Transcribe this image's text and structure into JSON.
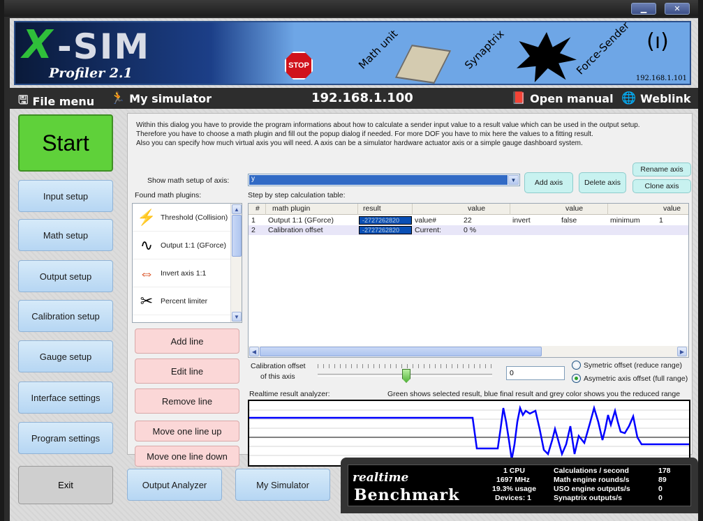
{
  "window": {
    "minimize": "▁",
    "close": "✕"
  },
  "banner": {
    "version": "Profiler 2.1",
    "math": "Math unit",
    "synaptrix": "Synaptrix",
    "force": "Force-Sender",
    "stop": "STOP",
    "ip": "192.168.1.101"
  },
  "menu": {
    "file": "File menu",
    "simulator": "My simulator",
    "ip": "192.168.1.100",
    "manual": "Open manual",
    "weblink": "Weblink"
  },
  "sidebar": {
    "start": "Start",
    "items": [
      "Input setup",
      "Math setup",
      "Output setup",
      "Calibration setup",
      "Gauge setup",
      "Interface settings",
      "Program settings"
    ],
    "exit": "Exit"
  },
  "intro": [
    "Within this dialog you have to provide the program informations about how to calculate a sender input value to a result value which can be used in the output setup.",
    "Therefore you have to choose a math plugin and fill out the popup dialog if needed. For more DOF you have to mix here the values to a fitting result.",
    "Also you can specify how much virtual axis you will need. A axis can be a simulator hardware actuator axis or a simple gauge dashboard system."
  ],
  "axis": {
    "label": "Show math setup of axis:",
    "value": "y"
  },
  "axis_buttons": {
    "add": "Add axis",
    "delete": "Delete axis",
    "rename": "Rename axis",
    "clone": "Clone axis"
  },
  "plugins": {
    "label": "Found math plugins:",
    "items": [
      {
        "icon": "⚡",
        "name": "Threshold (Collision)"
      },
      {
        "icon": "∿",
        "name": "Output 1:1 (GForce)"
      },
      {
        "icon": "⇔",
        "name": "Invert axis 1:1"
      },
      {
        "icon": "✂",
        "name": "Percent limiter"
      }
    ]
  },
  "line_buttons": {
    "add": "Add line",
    "edit": "Edit line",
    "remove": "Remove line",
    "up": "Move one line up",
    "down": "Move one line down"
  },
  "table": {
    "label": "Step by step calculation table:",
    "headers": [
      "#",
      "math plugin",
      "result",
      "value",
      "value",
      "value"
    ],
    "rows": [
      {
        "num": "1",
        "plugin": "Output 1:1 (GForce)",
        "result": "-2727262820",
        "c1": "value#",
        "c2": "22",
        "c3": "invert",
        "c4": "false",
        "c5": "minimum",
        "c6": "1"
      },
      {
        "num": "2",
        "plugin": "Calibration offset",
        "result": "-2727262820",
        "c1": "Current:",
        "c2": "0 %",
        "c3": "",
        "c4": "",
        "c5": "",
        "c6": ""
      }
    ]
  },
  "calibration": {
    "label1": "Calibration offset",
    "label2": "of this axis",
    "value": "0",
    "slider_fraction": 0.5,
    "opt1": "Symetric offset (reduce range)",
    "opt2": "Asymetric axis offset (full range)"
  },
  "analyzer": {
    "label": "Realtime result analyzer:",
    "legend": "Green shows selected result, blue final result and grey color shows you the reduced range",
    "line_color": "#0000ff"
  },
  "bottom": {
    "output_analyzer": "Output Analyzer",
    "my_simulator": "My Simulator"
  },
  "benchmark": {
    "logo1": "realtime",
    "logo2": "Benchmark",
    "sys": [
      "1 CPU",
      "1697 MHz",
      "19.3% usage",
      "Devices: 1"
    ],
    "stat_labels": [
      "Calculations / second",
      "Math engine rounds/s",
      "USO engine outputs/s",
      "Synaptrix outputs/s"
    ],
    "stat_values": [
      "178",
      "89",
      "0",
      "0"
    ]
  }
}
